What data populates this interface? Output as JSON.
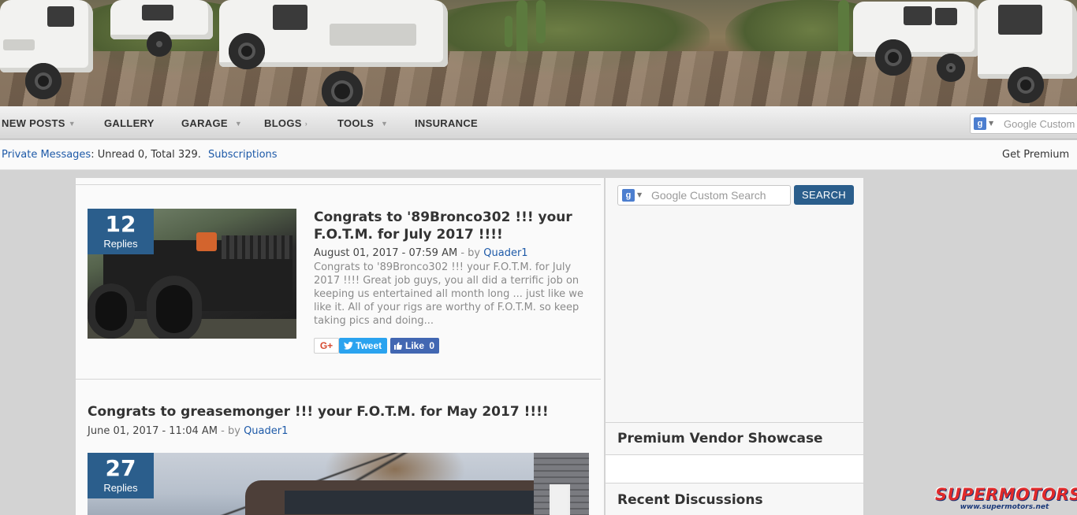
{
  "nav": {
    "items": [
      {
        "label": "NEW POSTS",
        "has_caret": true
      },
      {
        "label": "GALLERY",
        "has_caret": false
      },
      {
        "label": "GARAGE",
        "has_caret": true
      },
      {
        "label": "BLOGS",
        "has_caret": true
      },
      {
        "label": "TOOLS",
        "has_caret": true
      },
      {
        "label": "INSURANCE",
        "has_caret": false
      }
    ],
    "search_placeholder": "Google Custom"
  },
  "subbar": {
    "private_messages_label": "Private Messages",
    "pm_status": ": Unread 0, Total 329.",
    "subscriptions_label": "Subscriptions",
    "get_premium_label": "Get Premium"
  },
  "articles": [
    {
      "replies_count": "12",
      "replies_label": "Replies",
      "title": "Congrats to '89Bronco302 !!! your F.O.T.M. for July 2017 !!!!",
      "date": "August 01, 2017 - 07:59 AM",
      "by_label": "- by",
      "author": "Quader1",
      "excerpt": "Congrats to '89Bronco302 !!! your F.O.T.M. for July 2017 !!!! Great job guys, you all did a terrific job on keeping us entertained all month long ... just like we like it. All of your rigs are worthy of F.O.T.M. so keep taking pics and doing...",
      "share": {
        "gplus": "G+",
        "tweet": "Tweet",
        "like": "Like",
        "like_count": "0"
      }
    },
    {
      "replies_count": "27",
      "replies_label": "Replies",
      "title": "Congrats to greasemonger !!! your F.O.T.M. for May 2017 !!!!",
      "date": "June 01, 2017 - 11:04 AM",
      "by_label": "- by",
      "author": "Quader1"
    }
  ],
  "sidebar": {
    "search_placeholder": "Google Custom Search",
    "search_button": "SEARCH",
    "panels": [
      {
        "title": "Premium Vendor Showcase"
      },
      {
        "title": "Recent Discussions"
      }
    ]
  },
  "watermark": {
    "brand": "SUPERMOTORS",
    "url": "www.supermotors.net"
  },
  "colors": {
    "accent_blue": "#2b5e8c",
    "link": "#1e5aa8",
    "tweet": "#2aa3ef",
    "facebook": "#4267b2"
  },
  "icons": [
    "google-plus-icon",
    "twitter-bird-icon",
    "facebook-thumb-icon",
    "google-search-badge-icon",
    "chevron-down-icon"
  ]
}
